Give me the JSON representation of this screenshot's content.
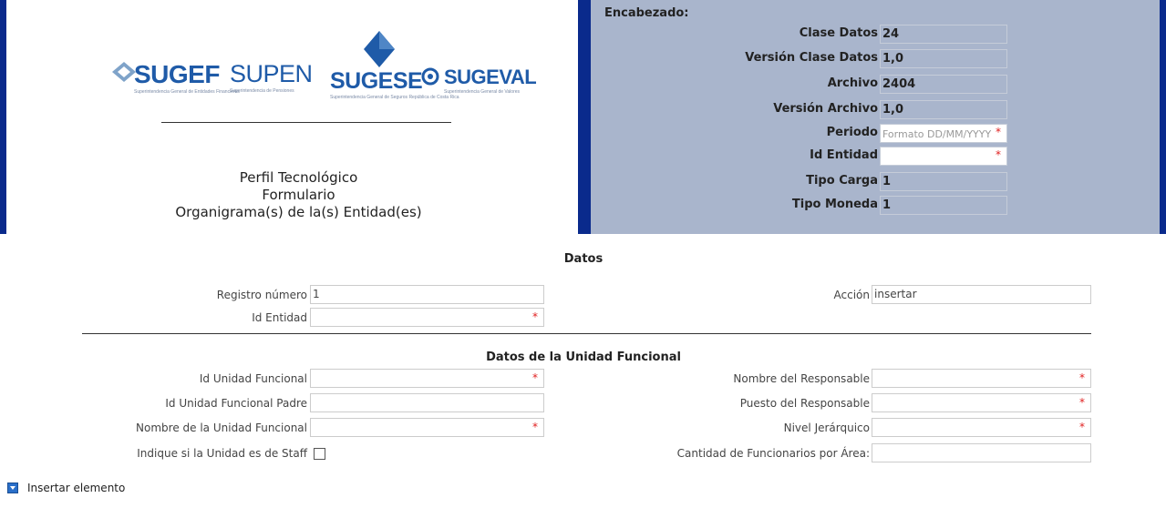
{
  "logos": {
    "sugef": "SUGEF",
    "sugef_sub": "Superintendencia General de Entidades Financieras",
    "supen": "SUPEN",
    "supen_sub": "Superintendencia de Pensiones",
    "sugese": "SUGESE",
    "sugese_sub": "Superintendencia General de Seguros República de Costa Rica",
    "sugeval": "SUGEVAL",
    "sugeval_sub": "Superintendencia General de Valores"
  },
  "title": {
    "line1": "Perfil Tecnológico",
    "line2": "Formulario",
    "line3": "Organigrama(s) de la(s) Entidad(es)"
  },
  "encabezado": {
    "label": "Encabezado:",
    "fields": [
      {
        "label": "Clase Datos",
        "value": "24"
      },
      {
        "label": "Versión Clase Datos",
        "value": "1,0"
      },
      {
        "label": "Archivo",
        "value": "2404"
      },
      {
        "label": "Versión Archivo",
        "value": "1,0"
      },
      {
        "label": "Periodo",
        "value": "",
        "placeholder": "Formato DD/MM/YYYY"
      },
      {
        "label": "Id Entidad",
        "value": ""
      },
      {
        "label": "Tipo Carga",
        "value": "1"
      },
      {
        "label": "Tipo Moneda",
        "value": "1"
      }
    ],
    "required_mark": "*"
  },
  "datos": {
    "title": "Datos",
    "registro_label": "Registro número",
    "registro_value": "1",
    "accion_label": "Acción",
    "accion_value": "insertar",
    "id_entidad_label": "Id Entidad"
  },
  "unidad": {
    "title": "Datos de la Unidad Funcional",
    "id_unidad_label": "Id Unidad Funcional",
    "id_padre_label": "Id Unidad Funcional Padre",
    "nombre_label": "Nombre de la Unidad Funcional",
    "staff_label": "Indique si la Unidad es de Staff",
    "responsable_label": "Nombre del Responsable",
    "puesto_label": "Puesto del Responsable",
    "nivel_label": "Nivel Jerárquico",
    "cantidad_label": "Cantidad de Funcionarios por Área:"
  },
  "insert": {
    "label": "Insertar elemento"
  },
  "colors": {
    "header_bg": "#a9b5cc",
    "border_blue": "#0a2a8c",
    "required": "#e02020"
  }
}
